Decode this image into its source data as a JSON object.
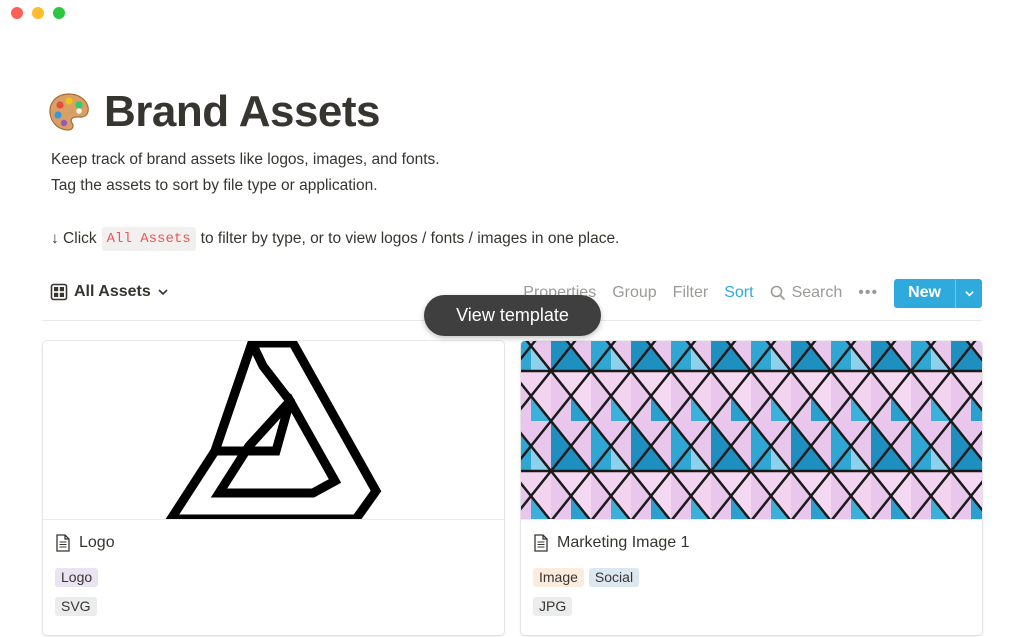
{
  "window": {
    "controls": [
      "close",
      "minimize",
      "zoom"
    ]
  },
  "page": {
    "icon": "artist-palette-icon",
    "title": "Brand Assets",
    "description_line1": "Keep track of brand assets like logos, images, and fonts.",
    "description_line2": "Tag the assets to sort by file type or application.",
    "hint_arrow": "↓ Click",
    "hint_chip": "All Assets",
    "hint_rest": "to filter by type, or to view logos / fonts / images in one place."
  },
  "toolbar": {
    "view_label": "All Assets",
    "view_icon": "gallery-icon",
    "properties_label": "Properties",
    "group_label": "Group",
    "filter_label": "Filter",
    "sort_label": "Sort",
    "search_label": "Search",
    "more_label": "•••",
    "new_label": "New"
  },
  "tooltip": {
    "label": "View template"
  },
  "cards": [
    {
      "title": "Logo",
      "cover": "impossible-triangle-logo",
      "tags_row1": [
        {
          "label": "Logo",
          "color": "#eae4f2"
        }
      ],
      "tags_row2": [
        {
          "label": "SVG",
          "color": "#ebeced"
        }
      ]
    },
    {
      "title": "Marketing Image 1",
      "cover": "geometric-triangle-facade",
      "tags_row1": [
        {
          "label": "Image",
          "color": "#fbecdd"
        },
        {
          "label": "Social",
          "color": "#dde7f0"
        }
      ],
      "tags_row2": [
        {
          "label": "JPG",
          "color": "#ebeced"
        }
      ]
    }
  ],
  "colors": {
    "accent": "#2eaadc",
    "code_text": "#eb5757",
    "text": "#37352f",
    "muted": "#9b9a97"
  }
}
